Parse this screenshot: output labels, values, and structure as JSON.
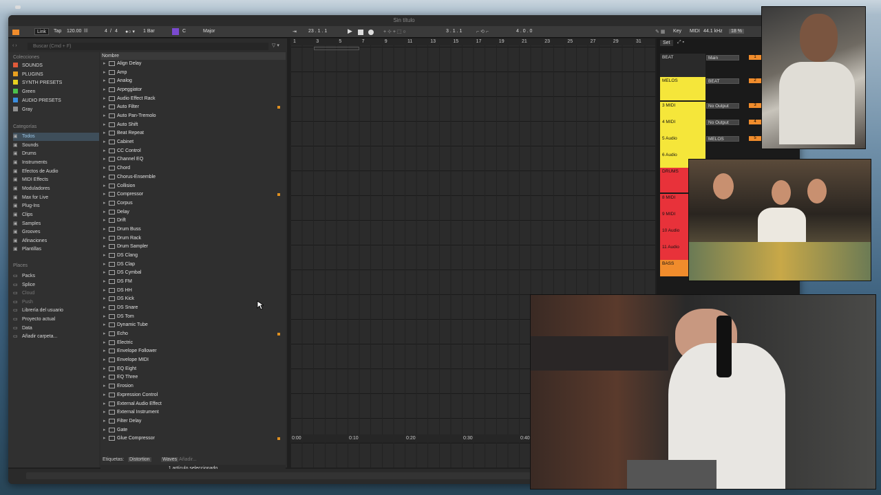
{
  "window": {
    "title": "Sin título"
  },
  "control_bar": {
    "link": "Link",
    "tap": "Tap",
    "tempo": "120.00",
    "time_sig_num": "4",
    "time_sig_den": "4",
    "quantize": "1 Bar",
    "key_root": "C",
    "scale": "Major",
    "position": "23 . 1 . 1",
    "loop_start": "3 . 1 . 1",
    "loop_length": "4 . 0 . 0",
    "key_label": "Key",
    "midi_label": "MIDI",
    "sample_rate": "44.1 kHz",
    "cpu": "18 %"
  },
  "browser": {
    "search_placeholder": "Buscar (Cmd + F)",
    "collections_title": "Colecciones",
    "collections": [
      {
        "label": "SOUNDS",
        "color": "#e05a3a"
      },
      {
        "label": "PLUGINS",
        "color": "#e8a020"
      },
      {
        "label": "SYNTH PRESETS",
        "color": "#e8d020"
      },
      {
        "label": "Green",
        "color": "#4cc04c"
      },
      {
        "label": "AUDIO PRESETS",
        "color": "#3a8ee0"
      },
      {
        "label": "Gray",
        "color": "#909090"
      }
    ],
    "categories_title": "Categorías",
    "categories": [
      "Todos",
      "Sounds",
      "Drums",
      "Instruments",
      "Efectos de Audio",
      "MIDI Effects",
      "Moduladores",
      "Max for Live",
      "Plug-Ins",
      "Clips",
      "Samples",
      "Grooves",
      "Afinaciones",
      "Plantillas"
    ],
    "places_title": "Places",
    "places": [
      "Packs",
      "Splice",
      "Cloud",
      "Push",
      "Librería del usuario",
      "Proyecto actual",
      "Data",
      "Añadir carpeta..."
    ],
    "list_header": "Nombre",
    "items": [
      "Align Delay",
      "Amp",
      "Analog",
      "Arpeggiator",
      "Audio Effect Rack",
      "Auto Filter",
      "Auto Pan-Tremolo",
      "Auto Shift",
      "Beat Repeat",
      "Cabinet",
      "CC Control",
      "Channel EQ",
      "Chord",
      "Chorus-Ensemble",
      "Collision",
      "Compressor",
      "Corpus",
      "Delay",
      "Drift",
      "Drum Buss",
      "Drum Rack",
      "Drum Sampler",
      "DS Clang",
      "DS Clap",
      "DS Cymbal",
      "DS FM",
      "DS HH",
      "DS Kick",
      "DS Snare",
      "DS Tom",
      "Dynamic Tube",
      "Echo",
      "Electric",
      "Envelope Follower",
      "Envelope MIDI",
      "EQ Eight",
      "EQ Three",
      "Erosion",
      "Expression Control",
      "External Audio Effect",
      "External Instrument",
      "Filter Delay",
      "Gate",
      "Glue Compressor"
    ],
    "tags_label": "Etiquetas:",
    "tag1": "Distortion",
    "tag2": "Waves",
    "tag_add": "Añadir...",
    "status": "1 artículo seleccionado"
  },
  "arrangement": {
    "ruler": [
      "1",
      "3",
      "5",
      "7",
      "9",
      "11",
      "13",
      "15",
      "17",
      "19",
      "21",
      "23",
      "25",
      "27",
      "29",
      "31"
    ],
    "times": [
      "0:00",
      "0:10",
      "0:20",
      "0:30",
      "0:40"
    ],
    "set_label": "Set"
  },
  "tracks": [
    {
      "name": "BEAT",
      "color": "#2a2a2a",
      "routing": "Main",
      "num": "1"
    },
    {
      "name": "MELOS",
      "color": "#f5e63a",
      "routing": "BEAT",
      "num": "2"
    },
    {
      "name": "3 MIDI",
      "color": "#f5e63a",
      "routing": "No Output",
      "num": "3"
    },
    {
      "name": "4 MIDI",
      "color": "#f5e63a",
      "routing": "No Output",
      "num": "4"
    },
    {
      "name": "5 Audio",
      "color": "#f5e63a",
      "routing": "MELOS",
      "num": "5"
    },
    {
      "name": "6 Audio",
      "color": "#f5e63a",
      "routing": "",
      "num": ""
    },
    {
      "name": "DRUMS",
      "color": "#e8323a",
      "routing": "",
      "num": ""
    },
    {
      "name": "8 MIDI",
      "color": "#e8323a",
      "routing": "",
      "num": ""
    },
    {
      "name": "9 MIDI",
      "color": "#e8323a",
      "routing": "",
      "num": ""
    },
    {
      "name": "10 Audio",
      "color": "#e8323a",
      "routing": "",
      "num": ""
    },
    {
      "name": "11 Audio",
      "color": "#e8323a",
      "routing": "",
      "num": ""
    },
    {
      "name": "BASS",
      "color": "#f08c2c",
      "routing": "",
      "num": ""
    }
  ]
}
